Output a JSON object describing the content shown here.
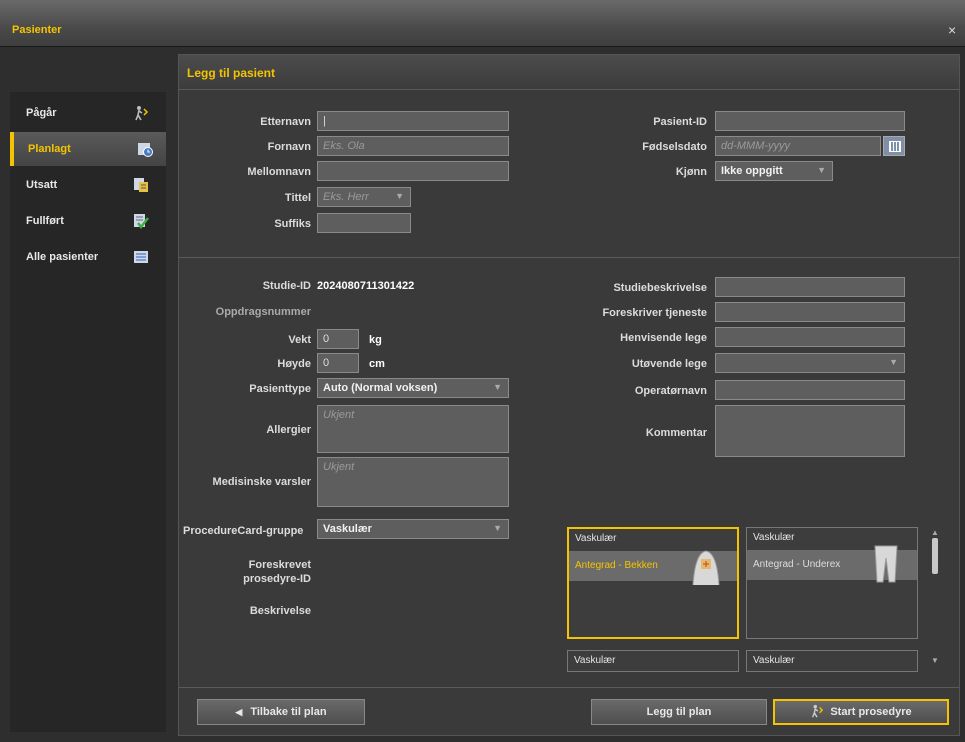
{
  "window": {
    "title": "Pasienter",
    "close": "×"
  },
  "sidebar": {
    "items": [
      {
        "label": "Pågår",
        "icon": "walking-person-icon",
        "active": false
      },
      {
        "label": "Planlagt",
        "icon": "clock-icon",
        "active": true
      },
      {
        "label": "Utsatt",
        "icon": "postponed-calendar-icon",
        "active": false
      },
      {
        "label": "Fullført",
        "icon": "checkmark-list-icon",
        "active": false
      },
      {
        "label": "Alle pasienter",
        "icon": "list-icon",
        "active": false
      }
    ]
  },
  "panel": {
    "title": "Legg til pasient"
  },
  "patient": {
    "etternavn": {
      "label": "Etternavn",
      "value": "|"
    },
    "fornavn": {
      "label": "Fornavn",
      "placeholder": "Eks. Ola"
    },
    "mellomnavn": {
      "label": "Mellomnavn",
      "value": ""
    },
    "tittel": {
      "label": "Tittel",
      "placeholder": "Eks. Herr"
    },
    "suffiks": {
      "label": "Suffiks",
      "value": ""
    },
    "pasient_id": {
      "label": "Pasient-ID",
      "value": ""
    },
    "fodselsdato": {
      "label": "Fødselsdato",
      "placeholder": "dd-MMM-yyyy"
    },
    "kjonn": {
      "label": "Kjønn",
      "value": "Ikke oppgitt"
    }
  },
  "study": {
    "studie_id": {
      "label": "Studie-ID",
      "value": "2024080711301422"
    },
    "oppdragsnummer": {
      "label": "Oppdragsnummer",
      "value": ""
    },
    "vekt": {
      "label": "Vekt",
      "value": "0",
      "unit": "kg"
    },
    "hoyde": {
      "label": "Høyde",
      "value": "0",
      "unit": "cm"
    },
    "pasienttype": {
      "label": "Pasienttype",
      "value": "Auto (Normal voksen)"
    },
    "allergier": {
      "label": "Allergier",
      "placeholder": "Ukjent"
    },
    "medisinske_varsler": {
      "label": "Medisinske varsler",
      "placeholder": "Ukjent"
    },
    "studiebeskrivelse": {
      "label": "Studiebeskrivelse",
      "value": ""
    },
    "foreskriver_tjeneste": {
      "label": "Foreskriver tjeneste",
      "value": ""
    },
    "henvisende_lege": {
      "label": "Henvisende lege",
      "value": ""
    },
    "utovende_lege": {
      "label": "Utøvende lege",
      "value": ""
    },
    "operatornavn": {
      "label": "Operatørnavn",
      "value": ""
    },
    "kommentar": {
      "label": "Kommentar",
      "value": ""
    }
  },
  "procedure": {
    "gruppe": {
      "label": "ProcedureCard-gruppe",
      "value": "Vaskulær"
    },
    "foreskrevet_label_1": "Foreskrevet",
    "foreskrevet_label_2": "prosedyre-ID",
    "beskrivelse_label": "Beskrivelse",
    "cards": [
      {
        "category": "Vaskulær",
        "name": "Antegrad - Bekken",
        "selected": true
      },
      {
        "category": "Vaskulær",
        "name": "Antegrad - Underex",
        "selected": false
      },
      {
        "category": "Vaskulær",
        "name": "",
        "selected": false
      },
      {
        "category": "Vaskulær",
        "name": "",
        "selected": false
      }
    ]
  },
  "buttons": {
    "back": "Tilbake til plan",
    "add_to_plan": "Legg til plan",
    "start": "Start prosedyre"
  },
  "colors": {
    "accent": "#f4c400"
  }
}
